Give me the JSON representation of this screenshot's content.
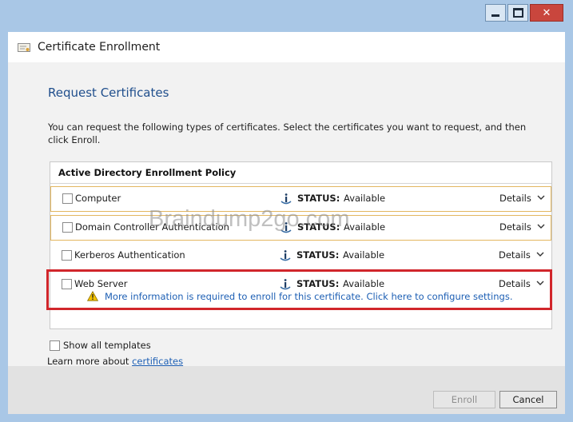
{
  "window": {
    "title": "Certificate Enrollment",
    "controls": [
      "minimize",
      "maximize",
      "close"
    ]
  },
  "page": {
    "heading": "Request Certificates",
    "description": "You can request the following types of certificates. Select the certificates you want to request, and then click Enroll."
  },
  "policy": {
    "header": "Active Directory Enrollment Policy",
    "templates": [
      {
        "name": "Computer",
        "status_label": "STATUS:",
        "status": "Available",
        "details": "Details",
        "checked": false
      },
      {
        "name": "Domain Controller Authentication",
        "status_label": "STATUS:",
        "status": "Available",
        "details": "Details",
        "checked": false
      },
      {
        "name": "Kerberos Authentication",
        "status_label": "STATUS:",
        "status": "Available",
        "details": "Details",
        "checked": false
      },
      {
        "name": "Web Server",
        "status_label": "STATUS:",
        "status": "Available",
        "details": "Details",
        "checked": false,
        "warning": "More information is required to enroll for this certificate. Click here to configure settings."
      }
    ]
  },
  "options": {
    "show_all": "Show all templates",
    "learn_more_prefix": "Learn more about",
    "learn_more_link": "certificates"
  },
  "buttons": {
    "enroll": "Enroll",
    "cancel": "Cancel"
  },
  "watermark": "Braindump2go.com",
  "colors": {
    "window_frame": "#a9c7e6",
    "heading": "#1f4e8c",
    "link": "#1d5fb4",
    "highlight": "#d1262b",
    "row_border": "#e3b760",
    "close_button": "#c9463d"
  },
  "icons": {
    "app": "certificate-icon",
    "status": "info-icon",
    "warning": "warning-icon",
    "details": "chevron-down-icon"
  }
}
